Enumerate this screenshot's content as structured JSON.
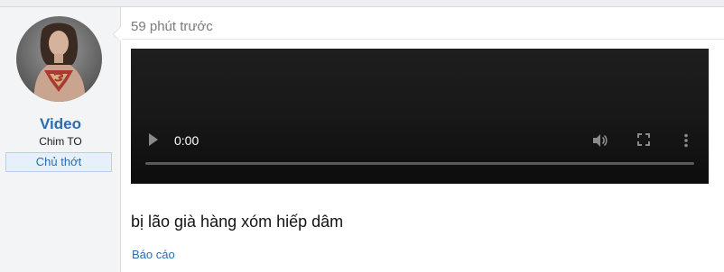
{
  "user": {
    "name": "Video",
    "title": "Chim TO",
    "banner": "Chủ thớt"
  },
  "post": {
    "timestamp": "59 phút trước",
    "content": "bị lão già hàng xóm hiếp dâm",
    "actions": {
      "report_label": "Báo cáo"
    }
  },
  "video": {
    "time": "0:00",
    "progress": 0,
    "icons": [
      "play-icon",
      "volume-icon",
      "fullscreen-icon",
      "more-options-icon"
    ]
  },
  "colors": {
    "link": "#2b6cb0",
    "user_cell_bg": "#f3f4f6",
    "video_bg": "#181818"
  }
}
